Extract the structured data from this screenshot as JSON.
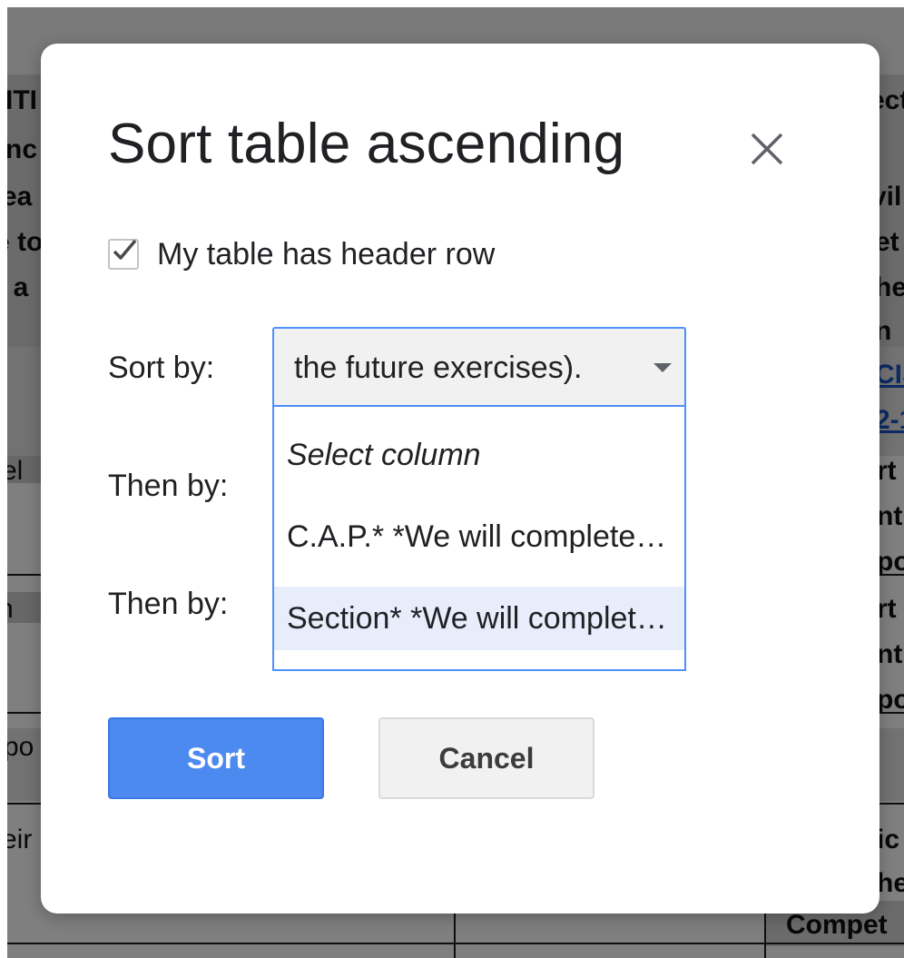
{
  "background_doc": {
    "fragments": [
      {
        "id": "frag-1",
        "text": "ITI"
      },
      {
        "id": "frag-2",
        "text": "nc"
      },
      {
        "id": "frag-3",
        "text": "ea"
      },
      {
        "id": "frag-4",
        "text": "e to"
      },
      {
        "id": "frag-5",
        "text": "l a"
      },
      {
        "id": "frag-6",
        "text": "el"
      },
      {
        "id": "frag-7",
        "text": "n"
      },
      {
        "id": "frag-8",
        "text": "po"
      },
      {
        "id": "frag-9",
        "text": "eir"
      },
      {
        "id": "frag-10",
        "text": "ect"
      },
      {
        "id": "frag-11",
        "text": "vil"
      },
      {
        "id": "frag-12",
        "text": "et"
      },
      {
        "id": "frag-13",
        "text": "he"
      },
      {
        "id": "frag-14",
        "text": "n"
      },
      {
        "id": "frag-15",
        "text": "CIS"
      },
      {
        "id": "frag-16",
        "text": "2-1"
      },
      {
        "id": "frag-17",
        "text": "rt"
      },
      {
        "id": "frag-18",
        "text": "nt"
      },
      {
        "id": "frag-19",
        "text": "po"
      },
      {
        "id": "frag-20",
        "text": "rt"
      },
      {
        "id": "frag-21",
        "text": "nt"
      },
      {
        "id": "frag-22",
        "text": "po"
      },
      {
        "id": "frag-23",
        "text": "ic"
      },
      {
        "id": "frag-24",
        "text": "he"
      },
      {
        "id": "frag-25",
        "text": "Compet"
      }
    ]
  },
  "dialog": {
    "title": "Sort table ascending",
    "close_label": "×",
    "header_row_checkbox": {
      "label": "My table has header row",
      "checked": true
    },
    "sort_by": {
      "label": "Sort by:",
      "selected_value": "the future exercises)."
    },
    "then_by_1": {
      "label": "Then by:"
    },
    "then_by_2": {
      "label": "Then by:"
    },
    "dropdown_options": [
      {
        "label": "Select column",
        "style": "placeholder"
      },
      {
        "label": "C.A.P.* *We will complete this table during the future exercises)."
      },
      {
        "label": "Section* *We will complete this table during the future exercises).",
        "highlighted": true
      }
    ],
    "sort_button": "Sort",
    "cancel_button": "Cancel"
  },
  "colors": {
    "primary_button": "#4d8af0",
    "focus_border": "#4d90fe",
    "highlight_row": "#e8edfb",
    "overlay": "rgba(0,0,0,0.5)"
  }
}
